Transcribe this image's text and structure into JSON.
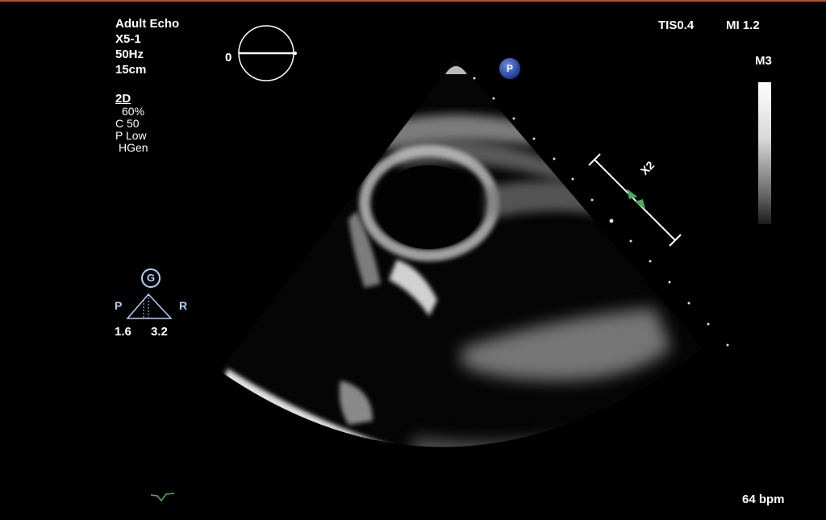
{
  "header": {
    "preset": "Adult Echo",
    "probe": "X5-1",
    "frame_rate": "50Hz",
    "depth": "15cm"
  },
  "mode": {
    "name": "2D",
    "params": [
      "60%",
      "C 50",
      "P Low",
      "HGen"
    ]
  },
  "indices": {
    "tis": "TIS0.4",
    "mi": "MI 1.2"
  },
  "angle_value": "0",
  "grayscale_map": "M3",
  "focus": {
    "gain_label": "G",
    "left_label": "P",
    "right_label": "R",
    "left_value": "1.6",
    "right_value": "3.2"
  },
  "orientation_marker": "P",
  "scale_label": "X2",
  "heart_rate": "64 bpm",
  "colors": {
    "accent_blue": "#a8d4ff",
    "caliper_green": "#3fb05a",
    "ecg_trace": "#4caf50"
  }
}
